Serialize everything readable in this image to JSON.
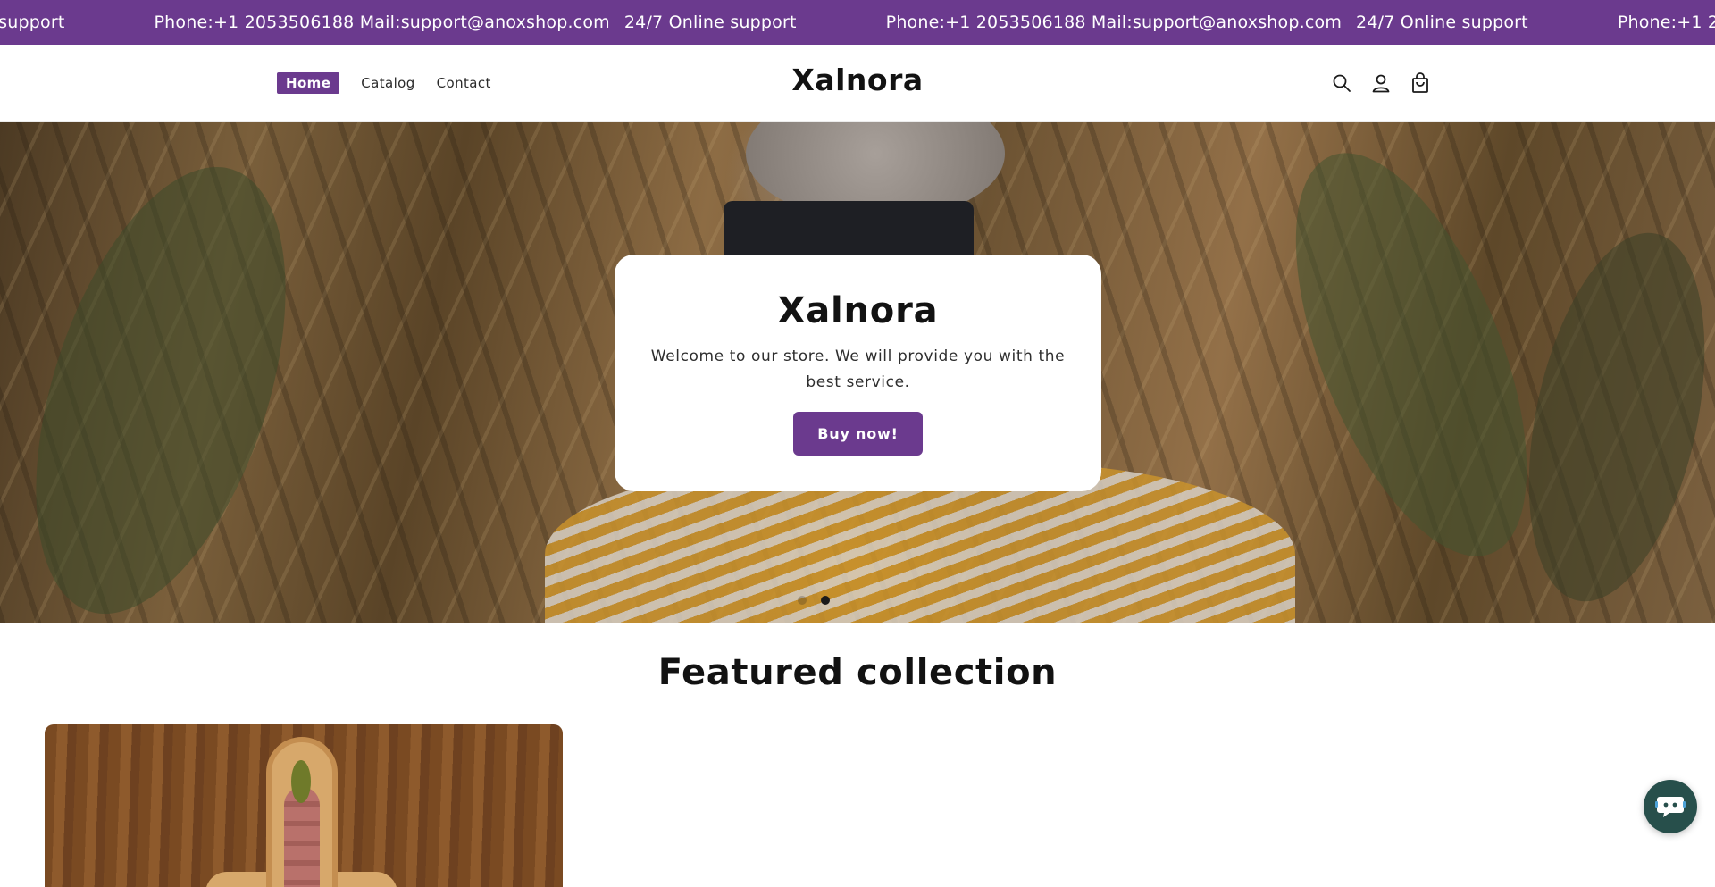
{
  "announcement": {
    "items": [
      "e support",
      "Phone:+1 2053506188 Mail:support@anoxshop.com",
      "24/7 Online support",
      "Phone:+1 2053506188 Mail:support@anoxshop.com",
      "24/7 Online support",
      "Phone:+1 2"
    ]
  },
  "header": {
    "nav": [
      "Home",
      "Catalog",
      "Contact"
    ],
    "active_nav": "Home",
    "logo": "Xalnora",
    "icons": [
      "search-icon",
      "account-icon",
      "cart-icon"
    ]
  },
  "hero": {
    "title": "Xalnora",
    "subtitle": "Welcome to our store. We will provide you with the best service.",
    "button_label": "Buy now!",
    "slide_count": 2,
    "active_slide": 2
  },
  "featured": {
    "title": "Featured collection"
  },
  "chat": {
    "icon": "chat-bubble-icon"
  },
  "colors": {
    "brand_purple": "#6b3a8e",
    "chat_green": "#274f4b"
  }
}
